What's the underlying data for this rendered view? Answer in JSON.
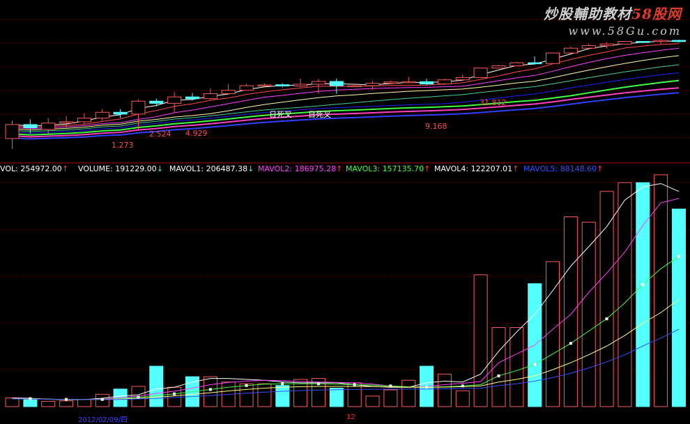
{
  "watermark": {
    "line1": "炒股輔助教材58股网",
    "line1_a": "炒股輔助教材",
    "line1_b": "58股网",
    "url": "www.58Gu.com"
  },
  "top_labels": {
    "left_a": "",
    "left_b": "",
    "left_c": ""
  },
  "price_annotations": {
    "cross_a": "日死叉",
    "cross_b": "日死叉",
    "p1": "1.273",
    "p2": "2.524",
    "p3": "4.929",
    "p4": "9.168",
    "p5": "31.812"
  },
  "volume_legend": {
    "vol": "VOL: 254972.00",
    "volume": "VOLUME: 191229.00",
    "mavol1": "MAVOL1: 206487.38",
    "mavol2": "MAVOL2: 186975.28",
    "mavol3": "MAVOL3: 157135.70",
    "mavol4": "MAVOL4: 122207.01",
    "mavol5": "MAVOL5: 88148.60"
  },
  "date_tag": "2012/02/09/四",
  "tick_12": "12",
  "colors": {
    "up": "#ff5a5a",
    "down": "#54ffff",
    "vol_line": "#ffffff",
    "mavol1": "#ffffff",
    "mavol2": "#ff40ff",
    "mavol3": "#40ff40",
    "mavol4": "#ffff80",
    "mavol5": "#3050ff"
  },
  "chart_data": [
    {
      "type": "candlestick",
      "title": "",
      "candles": [
        {
          "o": 0.8,
          "c": 1.5,
          "h": 1.8,
          "l": 0.5
        },
        {
          "o": 1.5,
          "c": 1.3,
          "h": 1.9,
          "l": 1.0
        },
        {
          "o": 1.2,
          "c": 1.6,
          "h": 2.0,
          "l": 1.0
        },
        {
          "o": 1.6,
          "c": 1.7,
          "h": 2.2,
          "l": 1.3
        },
        {
          "o": 1.7,
          "c": 2.0,
          "h": 2.5,
          "l": 1.5
        },
        {
          "o": 2.0,
          "c": 2.6,
          "h": 3.0,
          "l": 1.8
        },
        {
          "o": 2.6,
          "c": 2.4,
          "h": 3.0,
          "l": 2.0
        },
        {
          "o": 2.4,
          "c": 4.3,
          "h": 4.6,
          "l": 1.2
        },
        {
          "o": 4.3,
          "c": 3.9,
          "h": 4.8,
          "l": 3.4
        },
        {
          "o": 3.9,
          "c": 5.2,
          "h": 6.4,
          "l": 2.6
        },
        {
          "o": 5.2,
          "c": 4.8,
          "h": 6.2,
          "l": 4.4
        },
        {
          "o": 4.8,
          "c": 6.0,
          "h": 7.6,
          "l": 4.6
        },
        {
          "o": 6.0,
          "c": 7.0,
          "h": 9.2,
          "l": 5.7
        },
        {
          "o": 7.0,
          "c": 8.6,
          "h": 9.4,
          "l": 7.0
        },
        {
          "o": 8.6,
          "c": 8.9,
          "h": 9.6,
          "l": 8.4
        },
        {
          "o": 9.0,
          "c": 8.5,
          "h": 9.6,
          "l": 8.0
        },
        {
          "o": 8.5,
          "c": 9.2,
          "h": 11.8,
          "l": 8.0
        },
        {
          "o": 9.2,
          "c": 10.4,
          "h": 11.7,
          "l": 6.0
        },
        {
          "o": 10.4,
          "c": 8.6,
          "h": 11.9,
          "l": 6.0
        },
        {
          "o": 8.6,
          "c": 8.6,
          "h": 9.4,
          "l": 8.3
        },
        {
          "o": 8.6,
          "c": 9.6,
          "h": 10.6,
          "l": 7.2
        },
        {
          "o": 9.6,
          "c": 10.2,
          "h": 10.8,
          "l": 9.2
        },
        {
          "o": 10.2,
          "c": 10.3,
          "h": 12.8,
          "l": 9.6
        },
        {
          "o": 10.3,
          "c": 9.3,
          "h": 11.8,
          "l": 8.8
        },
        {
          "o": 9.3,
          "c": 11.2,
          "h": 11.8,
          "l": 8.8
        },
        {
          "o": 11.2,
          "c": 12.4,
          "h": 14.2,
          "l": 11.0
        },
        {
          "o": 12.4,
          "c": 19.0,
          "h": 19.0,
          "l": 12.2
        },
        {
          "o": 19.0,
          "c": 21.0,
          "h": 22.0,
          "l": 18.6
        },
        {
          "o": 21.0,
          "c": 24.2,
          "h": 25.0,
          "l": 20.6
        },
        {
          "o": 24.2,
          "c": 23.4,
          "h": 32.0,
          "l": 22.0
        },
        {
          "o": 23.4,
          "c": 37.5,
          "h": 37.5,
          "l": 23.0
        },
        {
          "o": 37.5,
          "c": 46.5,
          "h": 50.0,
          "l": 36.0
        },
        {
          "o": 46.5,
          "c": 52.0,
          "h": 56.5,
          "l": 44.0
        },
        {
          "o": 52.0,
          "c": 56.0,
          "h": 60.0,
          "l": 46.0
        },
        {
          "o": 56.0,
          "c": 63.0,
          "h": 64.0,
          "l": 56.0
        },
        {
          "o": 63.0,
          "c": 62.5,
          "h": 64.0,
          "l": 58.0
        },
        {
          "o": 62.5,
          "c": 66.0,
          "h": 70.0,
          "l": 56.0
        },
        {
          "o": 66.0,
          "c": 62.5,
          "h": 68.0,
          "l": 59.5
        }
      ]
    },
    {
      "type": "bar",
      "title": "",
      "ylim": [
        0,
        260000
      ],
      "series": [
        {
          "name": "VOLUME",
          "values": [
            10000,
            9000,
            6000,
            6500,
            8000,
            14000,
            20000,
            23000,
            46000,
            22000,
            34000,
            34000,
            28000,
            26000,
            26000,
            24000,
            31000,
            32000,
            21000,
            27000,
            12000,
            19000,
            30000,
            46000,
            37000,
            18000,
            150000,
            90000,
            90000,
            140000,
            165000,
            216000,
            210000,
            245000,
            255000,
            254972,
            264000,
            225000
          ]
        },
        {
          "name": "MAVOL1",
          "values": [
            10000,
            9500,
            8300,
            7800,
            7900,
            9500,
            12000,
            13500,
            20000,
            22000,
            28000,
            32000,
            32000,
            31000,
            30000,
            28000,
            27000,
            27000,
            27000,
            25000,
            23000,
            22000,
            22000,
            27000,
            29000,
            28000,
            37000,
            63000,
            85000,
            105000,
            132000,
            160000,
            182000,
            205000,
            235000,
            250000,
            254000,
            245000
          ]
        },
        {
          "name": "MAVOL2",
          "values": [
            9500,
            9200,
            8500,
            8000,
            8000,
            8400,
            10000,
            12000,
            15000,
            17500,
            21000,
            25000,
            27500,
            29000,
            30000,
            29500,
            28500,
            28000,
            27500,
            27000,
            25500,
            23500,
            22000,
            23000,
            25000,
            26500,
            28500,
            50000,
            60000,
            70000,
            88000,
            105000,
            130000,
            152000,
            176000,
            206000,
            232000,
            237000
          ]
        },
        {
          "name": "MAVOL3",
          "values": [
            9200,
            9000,
            8600,
            8200,
            8000,
            8200,
            9200,
            10700,
            12500,
            14500,
            17000,
            19500,
            22000,
            24000,
            25500,
            26000,
            26000,
            26000,
            25500,
            25000,
            24500,
            23500,
            22500,
            22000,
            22500,
            23500,
            25000,
            35000,
            41000,
            48000,
            60000,
            72000,
            86000,
            100000,
            118000,
            139000,
            157000,
            171000
          ]
        },
        {
          "name": "MAVOL4",
          "values": [
            9000,
            8800,
            8500,
            8200,
            8000,
            8100,
            8600,
            9500,
            10800,
            12200,
            14000,
            15800,
            17800,
            19500,
            21000,
            22000,
            22700,
            23000,
            23000,
            23000,
            22800,
            22500,
            22100,
            22000,
            22200,
            22700,
            23500,
            28000,
            31000,
            35000,
            42000,
            50000,
            59000,
            69000,
            81000,
            95000,
            107000,
            122000
          ]
        },
        {
          "name": "MAVOL5",
          "values": [
            8800,
            8600,
            8400,
            8200,
            8000,
            8000,
            8200,
            8700,
            9500,
            10400,
            11500,
            12600,
            13900,
            15200,
            16400,
            17400,
            18200,
            18800,
            19200,
            19500,
            19700,
            19800,
            19900,
            20000,
            20200,
            20500,
            21000,
            24000,
            26000,
            29000,
            33000,
            38000,
            44000,
            51000,
            59000,
            69000,
            78000,
            88000
          ]
        }
      ]
    }
  ]
}
